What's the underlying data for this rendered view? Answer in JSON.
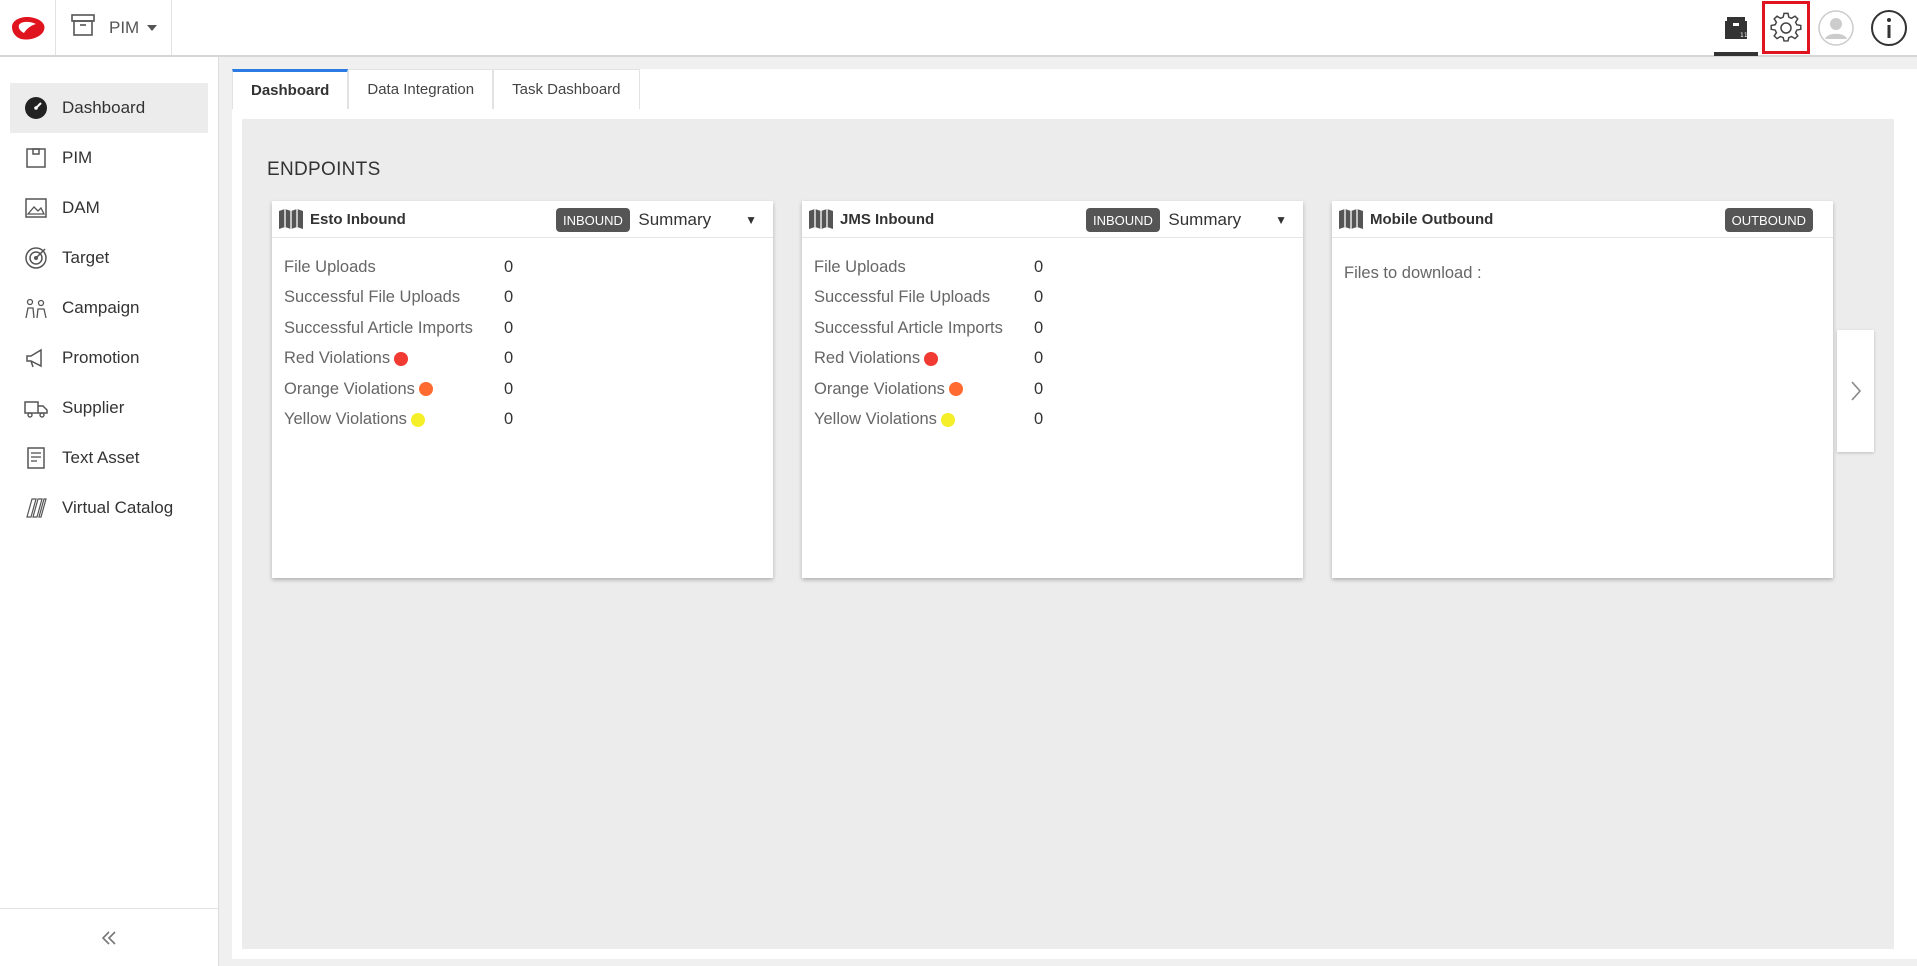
{
  "colors": {
    "brand": "#e0141e",
    "tab_accent": "#2c7be5",
    "red": "#f03a32",
    "orange": "#ff6a30",
    "yellow": "#f5ef2a",
    "badge": "#555555"
  },
  "header": {
    "module_label": "PIM",
    "icons": [
      "brand-logo",
      "archive-icon",
      "package-icon",
      "gear-icon",
      "user-avatar-icon",
      "info-icon"
    ]
  },
  "sidebar": {
    "items": [
      {
        "label": "Dashboard",
        "icon": "dashboard-icon"
      },
      {
        "label": "PIM",
        "icon": "pim-icon"
      },
      {
        "label": "DAM",
        "icon": "image-icon"
      },
      {
        "label": "Target",
        "icon": "target-icon"
      },
      {
        "label": "Campaign",
        "icon": "campaign-icon"
      },
      {
        "label": "Promotion",
        "icon": "megaphone-icon"
      },
      {
        "label": "Supplier",
        "icon": "truck-icon"
      },
      {
        "label": "Text Asset",
        "icon": "document-icon"
      },
      {
        "label": "Virtual Catalog",
        "icon": "catalog-icon"
      }
    ]
  },
  "tabs": [
    {
      "label": "Dashboard"
    },
    {
      "label": "Data Integration"
    },
    {
      "label": "Task Dashboard"
    }
  ],
  "section_title": "ENDPOINTS",
  "cards": [
    {
      "title": "Esto Inbound",
      "badge": "INBOUND",
      "dropdown": "Summary",
      "stats": [
        {
          "label": "File Uploads",
          "value": "0"
        },
        {
          "label": "Successful File Uploads",
          "value": "0"
        },
        {
          "label": "Successful Article Imports",
          "value": "0"
        },
        {
          "label": "Red Violations",
          "value": "0"
        },
        {
          "label": "Orange Violations",
          "value": "0"
        },
        {
          "label": "Yellow Violations",
          "value": "0"
        }
      ]
    },
    {
      "title": "JMS Inbound",
      "badge": "INBOUND",
      "dropdown": "Summary",
      "stats": [
        {
          "label": "File Uploads",
          "value": "0"
        },
        {
          "label": "Successful File Uploads",
          "value": "0"
        },
        {
          "label": "Successful Article Imports",
          "value": "0"
        },
        {
          "label": "Red Violations",
          "value": "0"
        },
        {
          "label": "Orange Violations",
          "value": "0"
        },
        {
          "label": "Yellow Violations",
          "value": "0"
        }
      ]
    },
    {
      "title": "Mobile Outbound",
      "badge": "OUTBOUND",
      "files_label": "Files to download :"
    }
  ]
}
